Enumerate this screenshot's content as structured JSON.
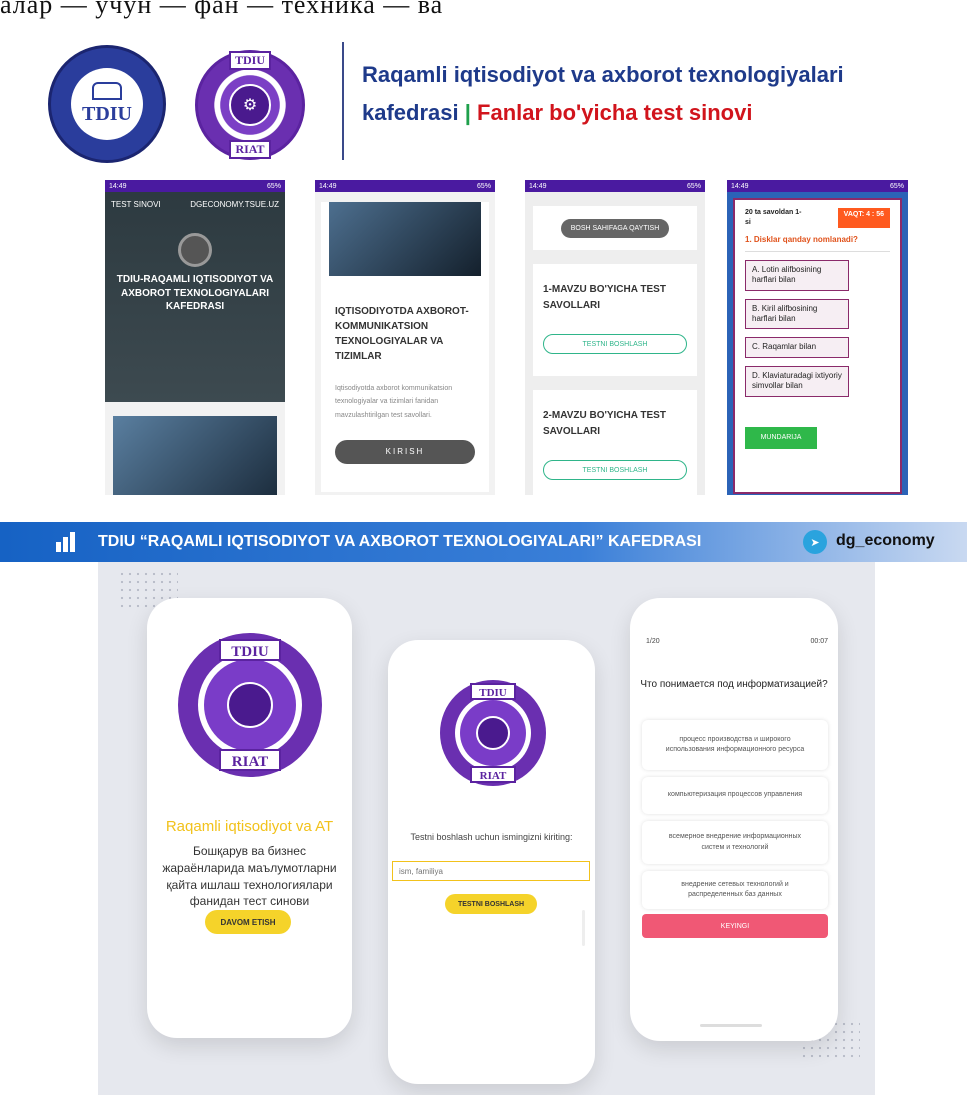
{
  "top_cut_text": "алар — учун — фан — техника — ва",
  "header": {
    "logo_tdiu_text": "TDIU",
    "logo_riat_top": "TDIU",
    "logo_riat_bottom": "RIAT",
    "title_line1": "Raqamli iqtisodiyot va axborot texnologiyalari",
    "title_line2_a": "kafedrasi",
    "title_line2_sep": "|",
    "title_line2_b": "Fanlar bo'yicha test sinovi"
  },
  "screens": {
    "status_time": "14:49",
    "status_battery": "65%",
    "s1": {
      "nav_left": "TEST SINOVI",
      "nav_right": "DGECONOMY.TSUE.UZ",
      "hero_text": "TDIU-RAQAMLI IQTISODIYOT VA AXBOROT TEXNOLOGIYALARI KAFEDRASI"
    },
    "s2": {
      "heading": "IQTISODIYOTDA AXBOROT-KOMMUNIKATSION TEXNOLOGIYALAR VA TIZIMLAR",
      "desc": "Iqtisodiyotda axborot kommunikatsion texnologiyalar va tizimlari fanidan mavzulashtirilgan test savollari.",
      "button": "KIRISH"
    },
    "s3": {
      "back_button": "BOSH SAHIFAGA QAYTISH",
      "cards": [
        {
          "title": "1-MAVZU BO'YICHA TEST SAVOLLARI",
          "button": "TESTNI BOSHLASH"
        },
        {
          "title": "2-MAVZU BO'YICHA TEST SAVOLLARI",
          "button": "TESTNI BOSHLASH"
        }
      ]
    },
    "s4": {
      "counter": "20 ta savoldan 1-si",
      "timer": "VAQT: 4 : 56",
      "question": "1. Disklar qanday nomlanadi?",
      "options": [
        "A. Lotin alifbosining harflari bilan",
        "B. Kiril alifbosining harflari bilan",
        "C. Raqamlar bilan",
        "D. Klaviaturadagi ixtiyoriy simvollar bilan"
      ],
      "button": "MUNDARIJA"
    }
  },
  "banner": {
    "text": "TDIU “RAQAMLI IQTISODIYOT VA AXBOROT TEXNOLOGIYALARI” KAFEDRASI",
    "handle": "dg_economy"
  },
  "mockups": {
    "m1": {
      "logo_top": "TDIU",
      "logo_bottom": "RIAT",
      "app_name": "Raqamli iqtisodiyot va AT",
      "description": "Бошқарув ва бизнес жараёнларида маълумотларни қайта ишлаш технологиялари фанидан тест синови",
      "button": "DAVOM ETISH"
    },
    "m2": {
      "logo_top": "TDIU",
      "logo_bottom": "RIAT",
      "prompt": "Testni boshlash uchun ismingizni kiriting:",
      "input_placeholder": "ism, familiya",
      "button": "TESTNI BOSHLASH"
    },
    "m3": {
      "counter": "1/20",
      "timer": "00:07",
      "question": "Что понимается под информатизацией?",
      "answers": [
        "процесс производства и широкого использования информационного ресурса",
        "компьютеризация процессов управления",
        "всемерное внедрение информационных систем и технологий",
        "внедрение сетевых технологий и распределенных баз данных"
      ],
      "button": "KEYINGI"
    }
  },
  "colors": {
    "brand_blue": "#1e3a8a",
    "accent_red": "#d1141c",
    "accent_green": "#1ea04b",
    "purple": "#5b23a0",
    "yellow": "#f5d32a",
    "pink_button": "#f05875"
  }
}
